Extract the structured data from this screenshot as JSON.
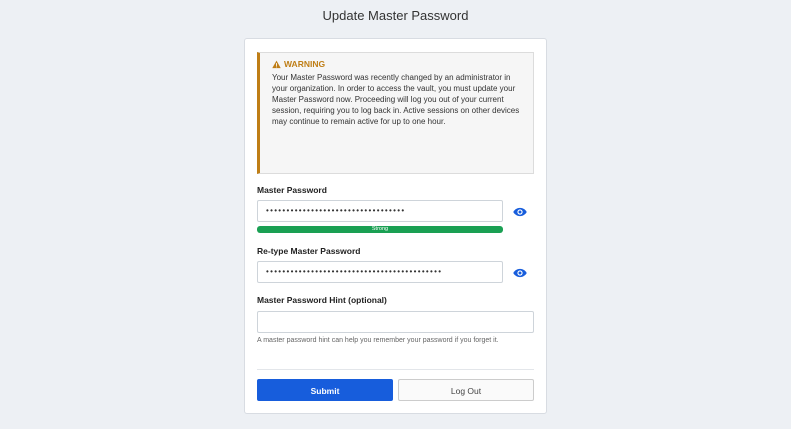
{
  "page": {
    "title": "Update Master Password"
  },
  "warning": {
    "heading": "WARNING",
    "body": "Your Master Password was recently changed by an administrator in your organization. In order to access the vault, you must update your Master Password now. Proceeding will log you out of your current session, requiring you to log back in. Active sessions on other devices may continue to remain active for up to one hour.",
    "color": "#bf7e16",
    "icon": "warning-triangle-icon"
  },
  "form": {
    "master_password": {
      "label": "Master Password",
      "value": "••••••••••••••••••••••••••••••••••",
      "toggle_icon": "eye-icon",
      "strength": {
        "label": "Strong",
        "fraction": 1.0,
        "color": "#1aa053"
      }
    },
    "retype_password": {
      "label": "Re-type Master Password",
      "value": "•••••••••••••••••••••••••••••••••••••••••••",
      "toggle_icon": "eye-icon"
    },
    "hint": {
      "label": "Master Password Hint (optional)",
      "value": "",
      "help": "A master password hint can help you remember your password if you forget it."
    }
  },
  "actions": {
    "submit_label": "Submit",
    "logout_label": "Log Out",
    "primary_color": "#175ddc"
  }
}
